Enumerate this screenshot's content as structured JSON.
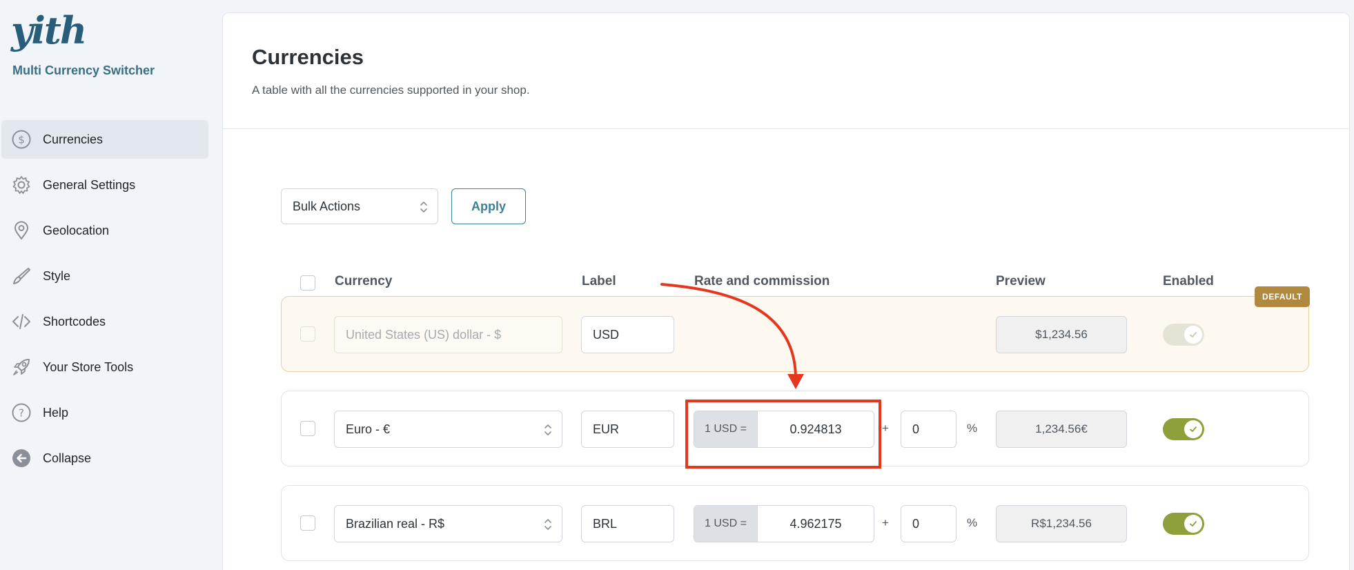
{
  "brand": {
    "logo_text": "yith",
    "plugin_name": "Multi Currency Switcher"
  },
  "sidebar": {
    "items": [
      {
        "label": "Currencies",
        "icon": "dollar-circle-icon",
        "active": true
      },
      {
        "label": "General Settings",
        "icon": "gear-icon"
      },
      {
        "label": "Geolocation",
        "icon": "map-pin-icon"
      },
      {
        "label": "Style",
        "icon": "brush-icon"
      },
      {
        "label": "Shortcodes",
        "icon": "code-icon"
      },
      {
        "label": "Your Store Tools",
        "icon": "rocket-icon"
      },
      {
        "label": "Help",
        "icon": "question-circle-icon"
      },
      {
        "label": "Collapse",
        "icon": "collapse-arrow-icon"
      }
    ]
  },
  "page": {
    "title": "Currencies",
    "subtitle": "A table with all the currencies supported in your shop."
  },
  "toolbar": {
    "bulk_actions": "Bulk Actions",
    "apply_label": "Apply"
  },
  "table": {
    "headers": {
      "currency": "Currency",
      "label": "Label",
      "rate": "Rate and commission",
      "preview": "Preview",
      "enabled": "Enabled"
    },
    "default_badge": "DEFAULT",
    "rows": [
      {
        "currency": "United States (US) dollar - $",
        "label": "USD",
        "preview": "$1,234.56",
        "enabled": true,
        "is_default": true
      },
      {
        "currency": "Euro - €",
        "label": "EUR",
        "rate_prefix": "1 USD =",
        "rate": "0.924813",
        "plus": "+",
        "commission": "0",
        "percent": "%",
        "preview": "1,234.56€",
        "enabled": true
      },
      {
        "currency": "Brazilian real - R$",
        "label": "BRL",
        "rate_prefix": "1 USD =",
        "rate": "4.962175",
        "plus": "+",
        "commission": "0",
        "percent": "%",
        "preview": "R$1,234.56",
        "enabled": true
      }
    ]
  },
  "colors": {
    "accent": "#3d7f93",
    "toggle_on": "#8da03b",
    "default_badge": "#b0883e",
    "annotation": "#e4371e"
  }
}
